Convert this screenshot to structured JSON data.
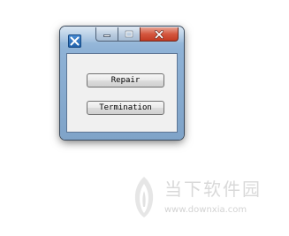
{
  "window": {
    "icon": "app-icon",
    "caption_buttons": [
      "minimize-icon",
      "maximize-icon",
      "close-icon"
    ]
  },
  "buttons": {
    "repair_label": "Repair",
    "termination_label": "Termination"
  },
  "watermark": {
    "brand": "当下软件园",
    "url": "www.downxia.com",
    "logo_icon": "downxia-logo-icon"
  },
  "colors": {
    "close_button": "#d4573f",
    "frame": "#8fb2d6",
    "client_bg": "#f0f0f0",
    "watermark": "#d9d9d9"
  }
}
